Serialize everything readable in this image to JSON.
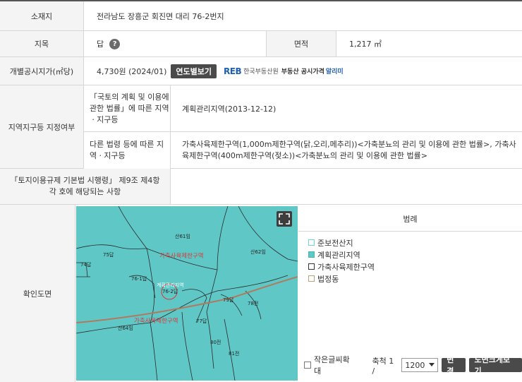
{
  "rows": {
    "location": {
      "label": "소재지",
      "value": "전라남도 장흥군 회진면 대리 76-2번지"
    },
    "land_category": {
      "label": "지목",
      "value": "답",
      "help": "?"
    },
    "area": {
      "label": "면적",
      "value": "1,217 ㎡"
    },
    "price": {
      "label": "개별공시지가(㎡당)",
      "value": "4,730원 (2024/01)",
      "button": "연도별보기",
      "reb_logo": "REB",
      "reb_org": "한국부동산원",
      "reb_service": "부동산 공시가격",
      "reb_alert": "알리미"
    },
    "zone": {
      "label": "지역지구등 지정여부",
      "sub1_label": "「국토의 계획 및 이용에 관한 법률」에 따른 지역ㆍ지구등",
      "sub1_value": "계획관리지역(2013-12-12)",
      "sub2_label": "다른 법령 등에 따른 지역ㆍ지구등",
      "sub2_value": "가축사육제한구역(1,000m제한구역(닭,오리,메추리))<가축분뇨의 관리 및 이용에 관한 법률>, 가축사육제한구역(400m제한구역(젖소))<가축분뇨의 관리 및 이용에 관한 법률>"
    },
    "decree": {
      "label": "「토지이용규제 기본법 시행령」 제9조 제4항 각 호에 해당되는 사항",
      "value": ""
    },
    "map_row": {
      "label": "확인도면"
    }
  },
  "map": {
    "parcels": [
      "산61임",
      "75답",
      "74답",
      "산62임",
      "76-1답",
      "계획관리지역",
      "76-2답",
      "79답",
      "78전",
      "77답",
      "산64임",
      "80전",
      "81전"
    ],
    "zone_labels": [
      "가축사육제한구역",
      "가축사육제한구역"
    ],
    "fill_color": "#5fc8c6"
  },
  "legend": {
    "title": "범례",
    "items": [
      {
        "label": "준보전산지",
        "color": "#6fd6cf",
        "fill": "#ffffff"
      },
      {
        "label": "계획관리지역",
        "color": "#46b8b2",
        "fill": "#5fc8c6"
      },
      {
        "label": "가축사육제한구역",
        "color": "#333333",
        "fill": "#ffffff"
      },
      {
        "label": "법정동",
        "color": "#b9a27a",
        "fill": "#ffffff"
      }
    ]
  },
  "controls": {
    "small_text": "작은글씨확대",
    "scale_label": "축척 1 /",
    "scale_value": "1200",
    "change_button": "변경",
    "enlarge_button": "도면크게보기"
  }
}
